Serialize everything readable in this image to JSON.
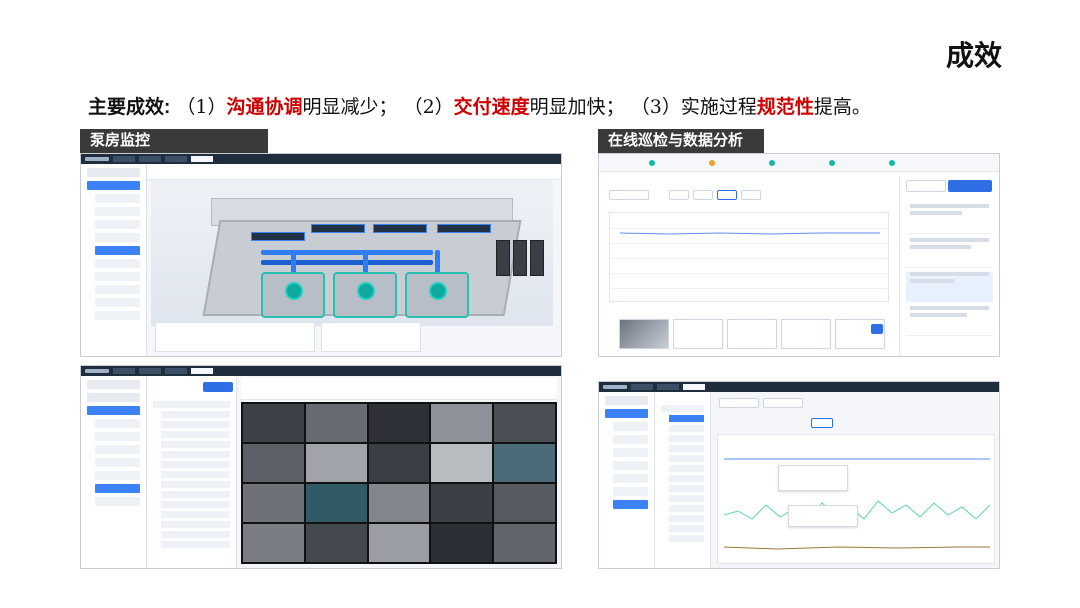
{
  "title": "成效",
  "summary": {
    "label": "主要成效",
    "colon": ":",
    "i1_num": "（1）",
    "i1_hl": "沟通协调",
    "i1_rest": "明显减少；",
    "i2_num": "（2）",
    "i2_hl": "交付速度",
    "i2_rest": "明显加快；",
    "i3_num": "（3）",
    "i3_pre": "实施过程",
    "i3_hl": "规范性",
    "i3_rest": "提高。"
  },
  "sections": {
    "pump_room": "泵房监控",
    "inspection": "在线巡检与数据分析"
  },
  "colors": {
    "highlight": "#d00000",
    "tag_bg": "#3a3a3a",
    "accent_blue": "#2f6fe6",
    "pump_teal": "#10a8a0",
    "pipe_blue": "#2f7df0"
  },
  "icons": [
    "app-logo-icon",
    "home-icon",
    "camera-icon"
  ]
}
